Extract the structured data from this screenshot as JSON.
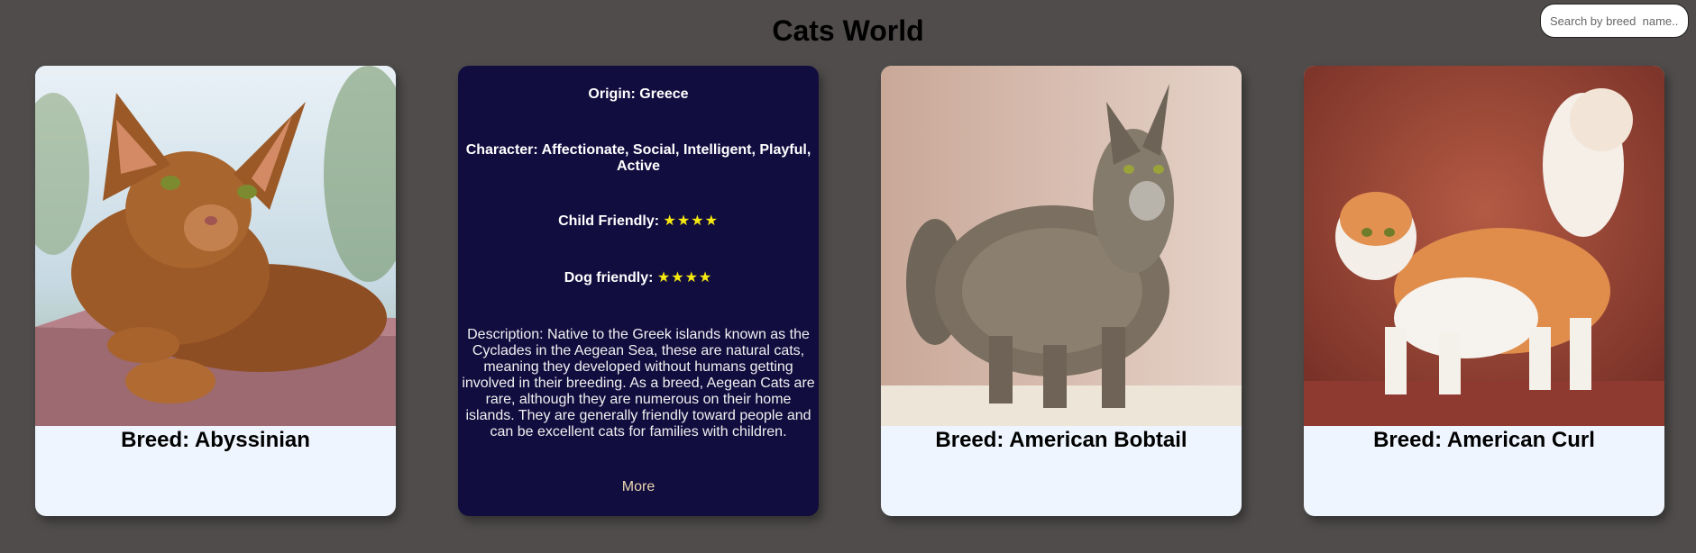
{
  "header": {
    "title": "Cats World",
    "search_placeholder": "Search by breed  name.."
  },
  "cards": [
    {
      "breed_label": "Breed: Abyssinian",
      "photo": "abyssinian-cat-photo"
    },
    {
      "origin": "Origin: Greece",
      "character": "Character: Affectionate, Social, Intelligent, Playful, Active",
      "child_friendly_label": "Child Friendly:",
      "child_friendly_stars": "★★★★",
      "child_friendly_rating": 4,
      "dog_friendly_label": "Dog friendly:",
      "dog_friendly_stars": "★★★★",
      "dog_friendly_rating": 4,
      "description": "Description: Native to the Greek islands known as the Cyclades in the Aegean Sea, these are natural cats, meaning they developed without humans getting involved in their breeding. As a breed, Aegean Cats are rare, although they are numerous on their home islands. They are generally friendly toward people and can be excellent cats for families with children.",
      "more_label": "More"
    },
    {
      "breed_label": "Breed: American Bobtail",
      "photo": "american-bobtail-cat-photo"
    },
    {
      "breed_label": "Breed: American Curl",
      "photo": "american-curl-cat-photo"
    }
  ],
  "colors": {
    "background": "#4f4c4b",
    "card_front": "#eff5fe",
    "card_back": "#120d3f",
    "star": "#f5e90f",
    "more_link": "#e8d6ae"
  }
}
